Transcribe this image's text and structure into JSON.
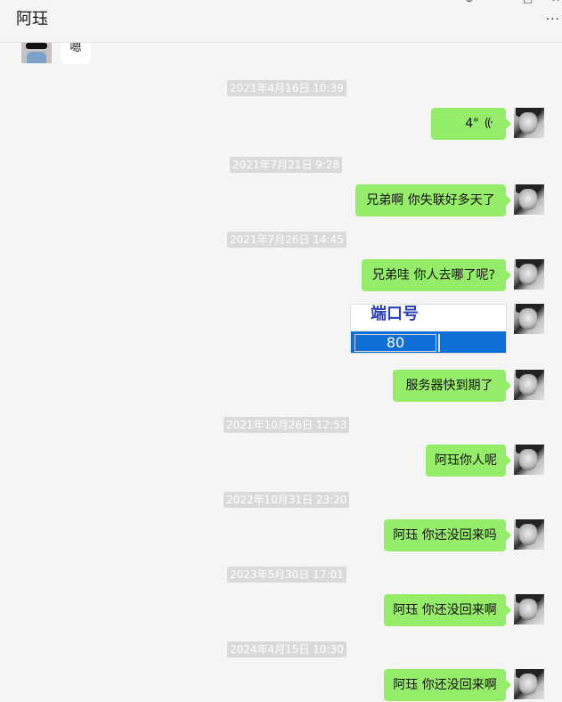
{
  "window": {
    "title": "阿珏",
    "controls": {
      "pin": "⊕",
      "maximize": "□",
      "close": "✕",
      "more": "···"
    }
  },
  "messages": [
    {
      "type": "text",
      "side": "left",
      "text": "嗯"
    },
    {
      "type": "timestamp",
      "text": "2021年4月16日 10:39"
    },
    {
      "type": "voice",
      "side": "right",
      "duration": "4\"",
      "icon": "voice-wave-icon"
    },
    {
      "type": "timestamp",
      "text": "2021年7月21日 9:28"
    },
    {
      "type": "text",
      "side": "right",
      "text": "兄弟啊  你失联好多天了"
    },
    {
      "type": "timestamp",
      "text": "2021年7月26日 14:45"
    },
    {
      "type": "text",
      "side": "right",
      "text": "兄弟哇  你人去哪了呢?"
    },
    {
      "type": "image",
      "side": "right",
      "label": "端口号",
      "value": "80"
    },
    {
      "type": "text",
      "side": "right",
      "text": "服务器快到期了"
    },
    {
      "type": "timestamp",
      "text": "2021年10月26日 12:53"
    },
    {
      "type": "text",
      "side": "right",
      "text": "阿珏你人呢"
    },
    {
      "type": "timestamp",
      "text": "2022年10月31日 23:20"
    },
    {
      "type": "text",
      "side": "right",
      "text": "阿珏 你还没回来吗"
    },
    {
      "type": "timestamp",
      "text": "2023年5月30日 17:01"
    },
    {
      "type": "text",
      "side": "right",
      "text": "阿珏 你还没回来啊"
    },
    {
      "type": "timestamp",
      "text": "2024年4月15日 10:30"
    },
    {
      "type": "text",
      "side": "right",
      "text": "阿珏 你还没回来啊"
    }
  ],
  "colors": {
    "self_bubble": "#95ec69",
    "other_bubble": "#ffffff",
    "background": "#f5f5f5",
    "timestamp_bg": "#dadada"
  }
}
